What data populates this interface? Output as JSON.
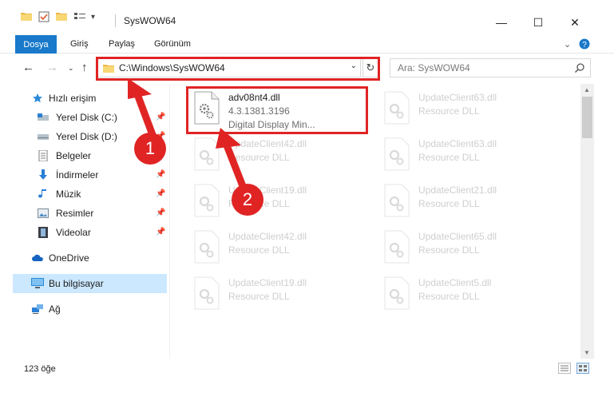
{
  "window": {
    "title": "SysWOW64",
    "controls": {
      "minimize": "—",
      "maximize": "☐",
      "close": "✕"
    }
  },
  "ribbon": {
    "tabs": [
      "Dosya",
      "Giriş",
      "Paylaş",
      "Görünüm"
    ],
    "expand_icon": "chevron-down-icon",
    "help_icon": "help-icon"
  },
  "address": {
    "path": "C:\\Windows\\SysWOW64",
    "search_placeholder": "Ara: SysWOW64"
  },
  "sidebar": {
    "items": [
      {
        "label": "Hızlı erişim",
        "icon": "star-icon"
      },
      {
        "label": "Yerel Disk (C:)",
        "icon": "drive-icon",
        "pinned": true
      },
      {
        "label": "Yerel Disk (D:)",
        "icon": "drive-icon",
        "pinned": true
      },
      {
        "label": "Belgeler",
        "icon": "documents-icon",
        "pinned": true
      },
      {
        "label": "İndirmeler",
        "icon": "download-icon",
        "pinned": true
      },
      {
        "label": "Müzik",
        "icon": "music-icon",
        "pinned": true
      },
      {
        "label": "Resimler",
        "icon": "pictures-icon",
        "pinned": true
      },
      {
        "label": "Videolar",
        "icon": "videos-icon",
        "pinned": true
      },
      {
        "label": "OneDrive",
        "icon": "cloud-icon"
      },
      {
        "label": "Bu bilgisayar",
        "icon": "computer-icon",
        "selected": true
      },
      {
        "label": "Ağ",
        "icon": "network-icon"
      }
    ]
  },
  "files": [
    {
      "name": "adv08nt4.dll",
      "version": "4.3.1381.3196",
      "description": "Digital Display Min...",
      "highlighted": true
    },
    {
      "name": "UpdateClient63.dll",
      "description": "Resource DLL"
    },
    {
      "name": "UpdateClient42.dll",
      "description": "Resource DLL"
    },
    {
      "name": "UpdateClient63.dll",
      "description": "Resource DLL"
    },
    {
      "name": "UpdateClient19.dll",
      "description": "Resource DLL"
    },
    {
      "name": "UpdateClient21.dll",
      "description": "Resource DLL"
    },
    {
      "name": "UpdateClient42.dll",
      "description": "Resource DLL"
    },
    {
      "name": "UpdateClient65.dll",
      "description": "Resource DLL"
    },
    {
      "name": "UpdateClient19.dll",
      "description": "Resource DLL"
    },
    {
      "name": "UpdateClient5.dll",
      "description": "Resource DLL"
    }
  ],
  "status": {
    "item_count": "123 öğe"
  },
  "annotations": {
    "badge1": "1",
    "badge2": "2",
    "color": "#e02424"
  }
}
